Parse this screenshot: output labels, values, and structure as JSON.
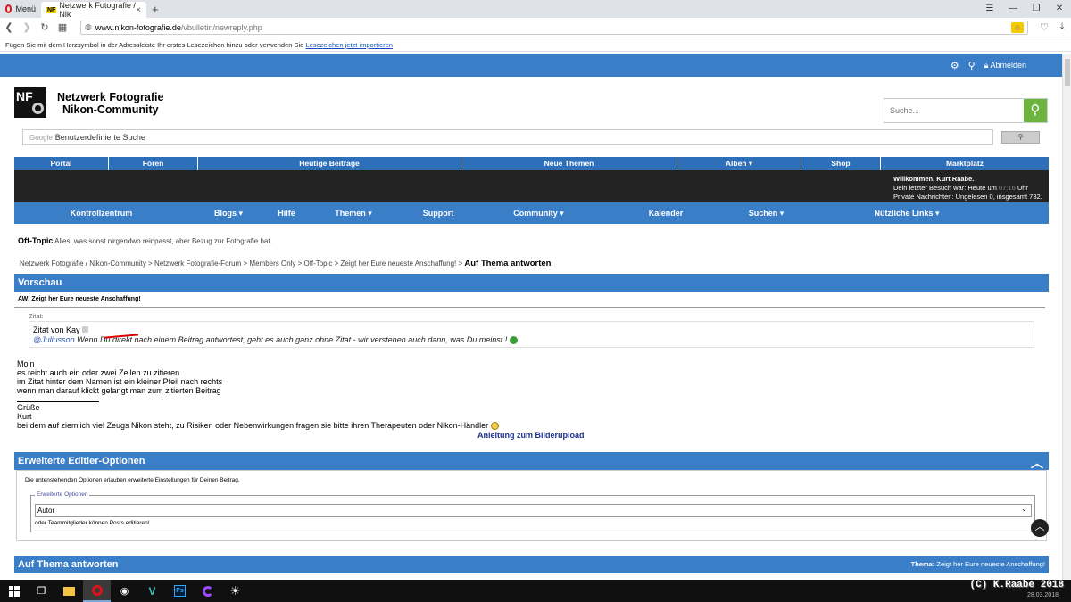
{
  "browser": {
    "menu_label": "Menü",
    "tab_badge": "NF",
    "tab_title": "Netzwerk Fotografie / Nik",
    "url_host": "www.nikon-fotografie.de",
    "url_path": "/vbulletin/newreply.php",
    "bookmark_hint": "Fügen Sie mit dem Herzsymbol in der Adressleiste Ihr erstes Lesezeichen hinzu oder verwenden Sie ",
    "bookmark_link": "Lesezeichen jetzt importieren"
  },
  "topbar": {
    "logout": "Abmelden"
  },
  "site": {
    "logo_text": "NF",
    "title_line1": "Netzwerk Fotografie",
    "title_line2": "Nikon-Community",
    "search_placeholder": "Suche...",
    "google_label": "Google",
    "google_placeholder": "Benutzerdefinierte Suche"
  },
  "navrow": [
    {
      "label": "Portal"
    },
    {
      "label": "Foren"
    },
    {
      "label": "Heutige Beiträge"
    },
    {
      "label": "Neue Themen"
    },
    {
      "label": "Alben ▾"
    },
    {
      "label": "Shop"
    },
    {
      "label": "Marktplatz"
    }
  ],
  "welcome": {
    "line1": "Willkommen, Kurt Raabe.",
    "line2a": "Dein letzter Besuch war: Heute um ",
    "line2time": "07:16",
    "line2b": " Uhr",
    "line3": "Private Nachrichten: Ungelesen 0, insgesamt 732."
  },
  "mainnav": [
    {
      "label": "Kontrollzentrum"
    },
    {
      "label": "Blogs ▾"
    },
    {
      "label": "Hilfe"
    },
    {
      "label": "Themen ▾"
    },
    {
      "label": "Support"
    },
    {
      "label": "Community ▾"
    },
    {
      "label": "Kalender"
    },
    {
      "label": "Suchen ▾"
    },
    {
      "label": "Nützliche Links ▾"
    }
  ],
  "forum": {
    "title": "Off-Topic",
    "description": " Alles, was sonst nirgendwo reinpasst, aber Bezug zur Fotografie hat."
  },
  "breadcrumb": {
    "path": "Netzwerk Fotografie / Nikon-Community > Netzwerk Fotografie-Forum > Members Only > Off-Topic > Zeigt her Eure neueste Anschaffung! > ",
    "current": "Auf Thema antworten"
  },
  "preview": {
    "heading": "Vorschau",
    "subject": "AW: Zeigt her Eure neueste Anschaffung!",
    "quote_label": "Zitat:",
    "quote_author_prefix": "Zitat von ",
    "quote_author": "Kay",
    "quote_mention": "@Juliusson",
    "quote_text": " Wenn Du direkt nach einem Beitrag antwortest, geht es auch ganz ohne Zitat - wir verstehen auch dann, was Du meinst ! ",
    "message_lines": [
      "Moin",
      "es reicht auch ein oder zwei Zeilen zu zitieren",
      "im Zitat hinter dem Namen ist ein kleiner Pfeil nach rechts",
      "wenn man darauf klickt gelangt man zum zitierten Beitrag"
    ],
    "sig_lines": [
      "Grüße",
      "Kurt"
    ],
    "sig_text": "bei dem auf ziemlich viel Zeugs Nikon steht, zu Risiken oder Nebenwirkungen fragen sie bitte ihren Therapeuten oder Nikon-Händler ",
    "upload_link": "Anleitung zum Bilderupload"
  },
  "advanced": {
    "heading": "Erweiterte Editier-Optionen",
    "description": "Die untenstehenden Optionen erlauben erweiterte Einstellungen für Deinen Beitrag.",
    "legend": "Erweiterte Optionen",
    "selected": "Autor",
    "note": "oder Teammitglieder können Posts editieren!"
  },
  "reply": {
    "heading": "Auf Thema antworten",
    "thema_label": "Thema:",
    "thema_value": " Zeigt her Eure neueste Anschaffung!"
  },
  "taskbar": {
    "copyright": "(C) K.Raabe 2018",
    "date": "28.03.2018",
    "ps_label": "Ps"
  }
}
